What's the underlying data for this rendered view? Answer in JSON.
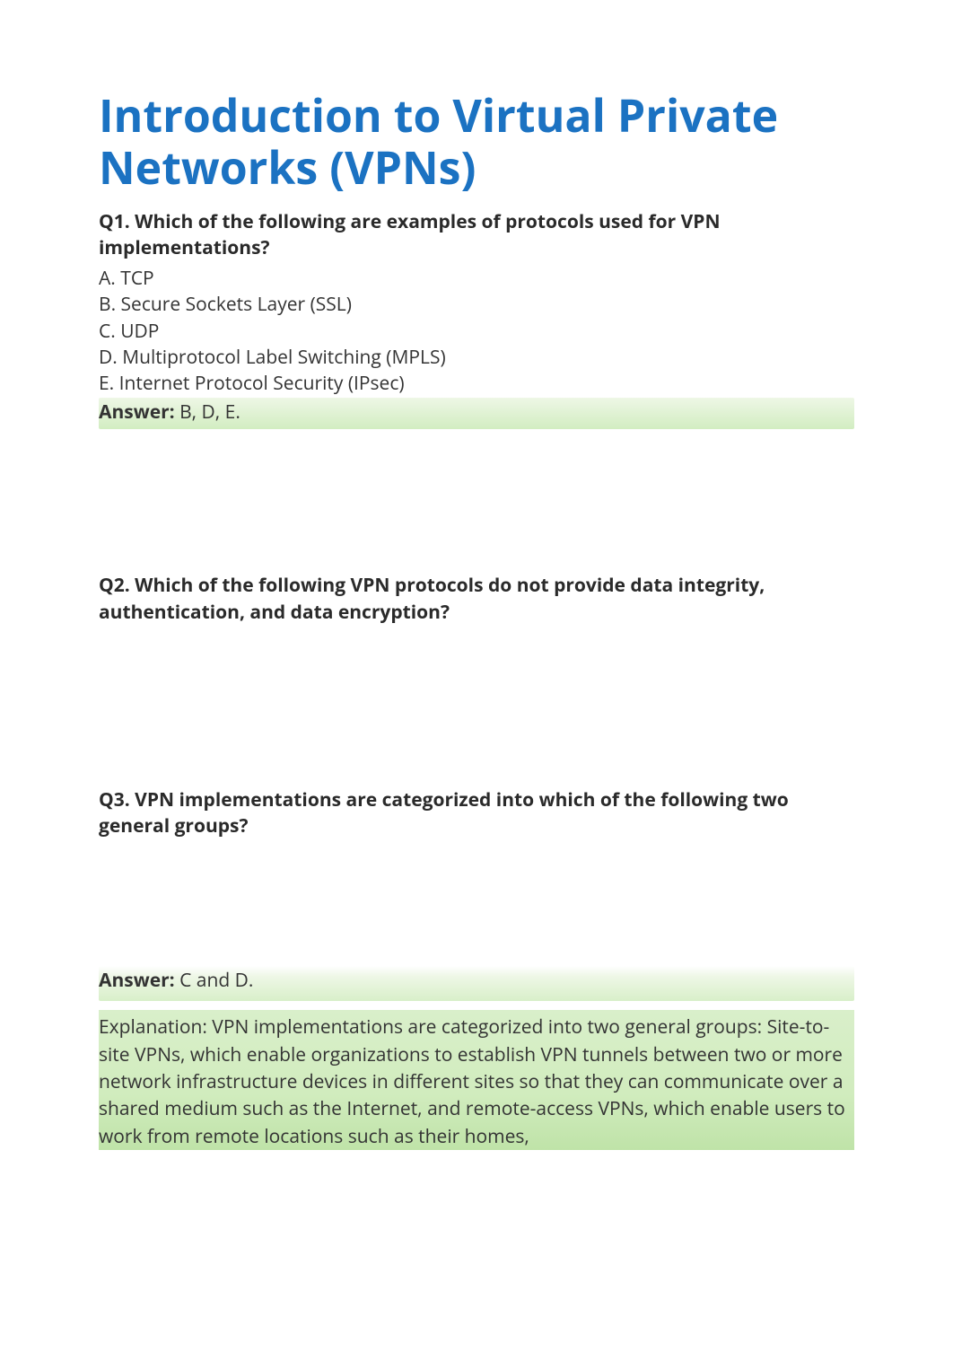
{
  "title": "Introduction to Virtual Private Networks (VPNs)",
  "q1": {
    "prompt": "Q1. Which of the following are examples of protocols used for VPN implementations?",
    "options": {
      "a": "A. TCP",
      "b": "B. Secure Sockets Layer (SSL)",
      "c": "C. UDP",
      "d": "D. Multiprotocol Label Switching (MPLS)",
      "e": "E. Internet Protocol Security (IPsec)"
    },
    "answer_label": "Answer: ",
    "answer_value": "B, D, E."
  },
  "q2": {
    "prompt": "Q2. Which of the following VPN protocols do not provide data integrity, authentication, and data encryption?"
  },
  "q3": {
    "prompt": "Q3. VPN implementations are categorized into which of the following two general groups?",
    "answer_label": "Answer: ",
    "answer_value": "C and D.",
    "explanation": "Explanation:  VPN implementations are categorized into two general groups: Site-to-site VPNs, which enable organizations to establish VPN tunnels between two or more network infrastructure devices in different sites so that they can communicate over a shared medium such as the Internet, and remote-access VPNs, which enable users to work from remote locations such as their homes,"
  }
}
